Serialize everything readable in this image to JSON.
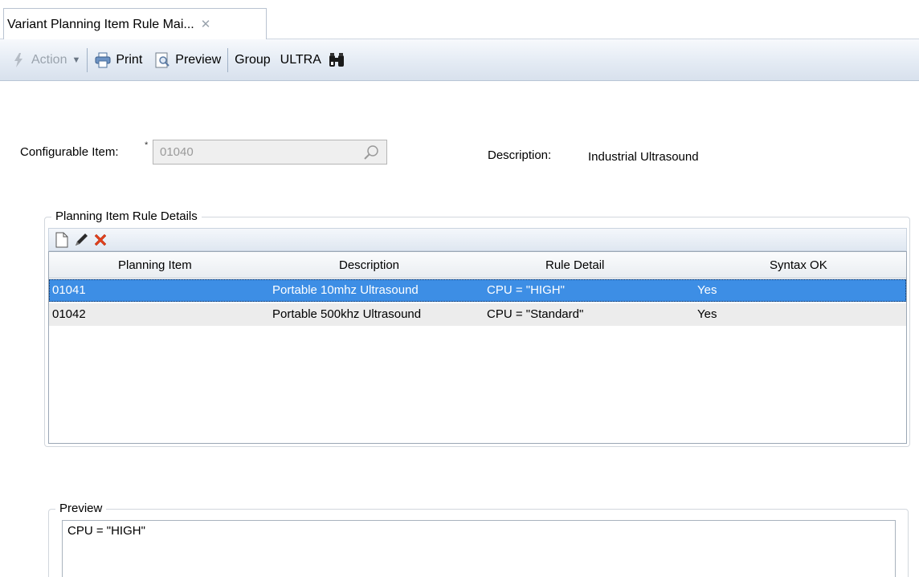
{
  "tab": {
    "title": "Variant Planning Item Rule Mai..."
  },
  "toolbar": {
    "action_label": "Action",
    "print_label": "Print",
    "preview_label": "Preview",
    "group_label": "Group",
    "group_value": "ULTRA"
  },
  "header": {
    "configurable_item_label": "Configurable Item:",
    "required_marker": "*",
    "configurable_item_value": "01040",
    "description_label": "Description:",
    "description_value": "Industrial Ultrasound"
  },
  "rules": {
    "legend": "Planning Item Rule Details",
    "columns": [
      "Planning Item",
      "Description",
      "Rule Detail",
      "Syntax OK"
    ],
    "rows": [
      {
        "planning_item": "01041",
        "description": "Portable 10mhz Ultrasound",
        "rule_detail": "CPU = \"HIGH\"",
        "syntax_ok": "Yes",
        "selected": true
      },
      {
        "planning_item": "01042",
        "description": "Portable 500khz Ultrasound",
        "rule_detail": "CPU = \"Standard\"",
        "syntax_ok": "Yes",
        "selected": false
      }
    ]
  },
  "preview": {
    "legend": "Preview",
    "text": "CPU = \"HIGH\""
  },
  "colors": {
    "selection": "#3d8ee5",
    "delete_icon": "#e0401c"
  },
  "icons": [
    "close-icon",
    "lightning-icon",
    "printer-icon",
    "preview-icon",
    "binoculars-icon",
    "search-icon",
    "new-document-icon",
    "pencil-icon",
    "delete-icon"
  ]
}
